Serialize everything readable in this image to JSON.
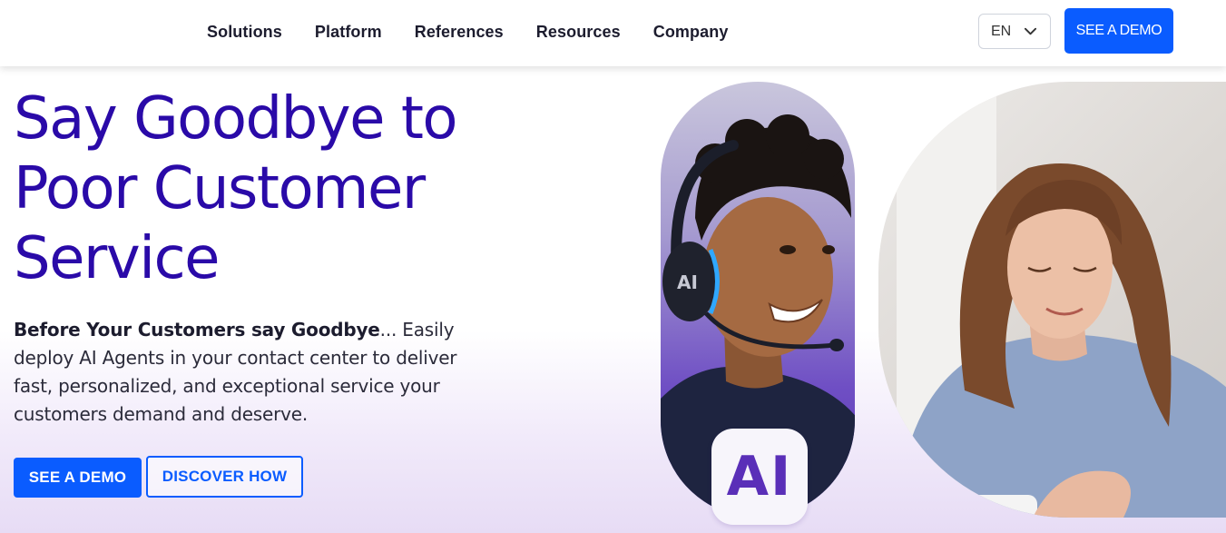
{
  "nav": {
    "items": [
      "Solutions",
      "Platform",
      "References",
      "Resources",
      "Company"
    ]
  },
  "language": {
    "selected": "EN",
    "icon": "chevron-down-icon"
  },
  "header_cta": {
    "label": "SEE A DEMO"
  },
  "hero": {
    "title_line1": "Say Goodbye to",
    "title_line2": "Poor Customer",
    "title_line3": "Service",
    "subtitle_bold": "Before Your Customers say Goodbye",
    "subtitle_rest": "... Easily deploy AI Agents in your contact center to deliver fast, personalized, and exceptional service your customers demand and deserve.",
    "primary_cta": "SEE A DEMO",
    "secondary_cta": "DISCOVER HOW"
  },
  "media": {
    "agent_headset_label": "AI",
    "ai_badge": "AI"
  },
  "colors": {
    "brand_blue": "#0a5cff",
    "title_purple": "#2a0aa8",
    "accent_purple": "#5a2fb8"
  }
}
